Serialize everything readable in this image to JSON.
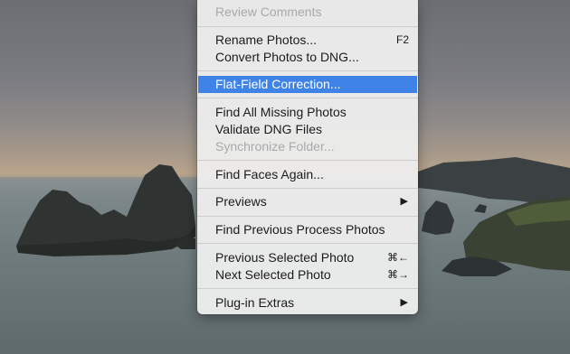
{
  "menu": {
    "review_comments": "Review Comments",
    "rename_photos": "Rename Photos...",
    "rename_shortcut": "F2",
    "convert_dng": "Convert Photos to DNG...",
    "flat_field": "Flat-Field Correction...",
    "find_missing": "Find All Missing Photos",
    "validate_dng": "Validate DNG Files",
    "synchronize_folder": "Synchronize Folder...",
    "find_faces": "Find Faces Again...",
    "previews": "Previews",
    "find_previous_process": "Find Previous Process Photos",
    "previous_selected": "Previous Selected Photo",
    "previous_shortcut": "⌘←",
    "next_selected": "Next Selected Photo",
    "next_shortcut": "⌘→",
    "plugin_extras": "Plug-in Extras",
    "submenu_arrow": "▶"
  },
  "colors": {
    "highlight": "#3f83e6",
    "disabled_text": "#a9a9a9"
  }
}
